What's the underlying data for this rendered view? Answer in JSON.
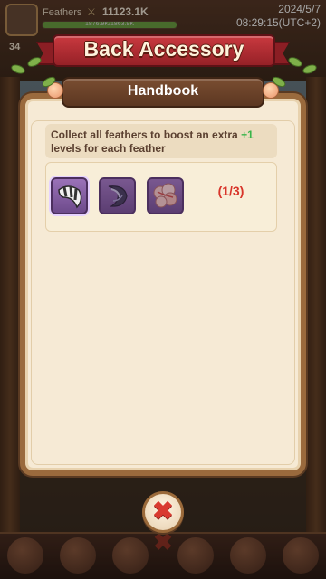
{
  "status": {
    "player_label": "Feathers",
    "power_icon": "crossed-swords-icon",
    "power": "11123.1K",
    "exp_text": "1876.9K/1863.9K",
    "exp_fraction": 1.0,
    "gem_count": "34",
    "date": "2024/5/7",
    "time": "08:29:15(UTC+2)"
  },
  "banner": {
    "title": "Back Accessory"
  },
  "handbook": {
    "title": "Handbook",
    "desc_before": "Collect all feathers to boost an extra ",
    "desc_highlight": "+1",
    "desc_after": " levels for each feather",
    "progress": "(1/3)",
    "items": [
      {
        "icon": "striped-feather-icon",
        "owned": true
      },
      {
        "icon": "moon-feather-icon",
        "owned": false
      },
      {
        "icon": "pink-plume-icon",
        "owned": false
      }
    ]
  },
  "close_button": {
    "icon": "close-icon",
    "glyph": "✖"
  },
  "colors": {
    "accent_red": "#d8342a",
    "highlight_green": "#39b54a",
    "parchment": "#f6ead5",
    "slot_purple": "#7d58a0"
  }
}
